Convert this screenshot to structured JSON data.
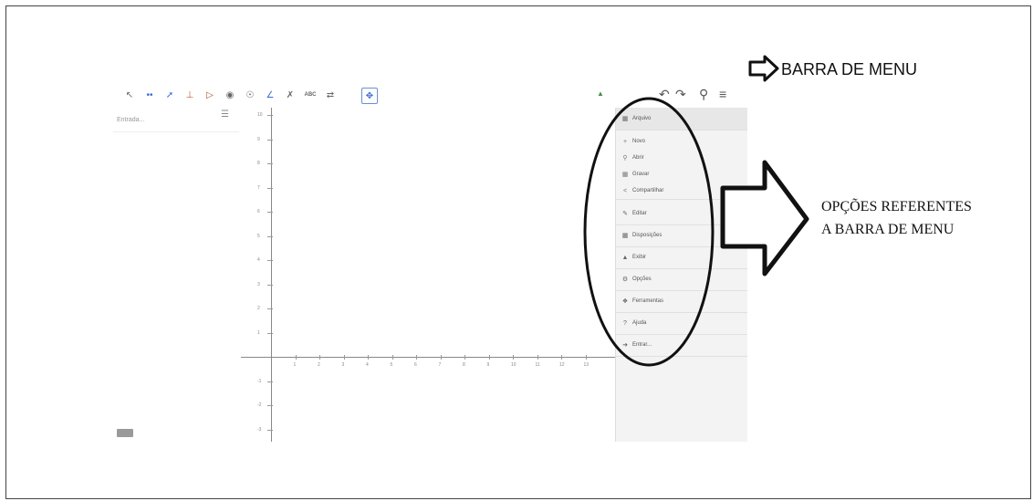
{
  "toolbar": {
    "tools": [
      "move-tool",
      "point-tool",
      "line-tool",
      "perpendicular-tool",
      "polygon-tool",
      "circle-tool",
      "circle-three-points-tool",
      "angle-tool",
      "reflect-tool",
      "text-tool",
      "slider-tool",
      "move-graphics-tool"
    ],
    "text_tool_label": "ABC",
    "right_icons": [
      "undo-icon",
      "redo-icon",
      "search-icon",
      "hamburger-menu-icon"
    ]
  },
  "algebra": {
    "input_placeholder": "Entrada..."
  },
  "graphics": {
    "y_ticks": [
      "10",
      "9",
      "8",
      "7",
      "6",
      "5",
      "4",
      "3",
      "2",
      "1",
      "-1",
      "-2",
      "-3"
    ],
    "x_ticks": [
      "1",
      "2",
      "3",
      "4",
      "5",
      "6",
      "7",
      "8",
      "9",
      "10",
      "11",
      "12",
      "13"
    ]
  },
  "menu": {
    "header": "Arquivo",
    "file_items": [
      {
        "label": "Novo",
        "icon": "plus-icon"
      },
      {
        "label": "Abrir",
        "icon": "search-icon"
      },
      {
        "label": "Gravar",
        "icon": "save-icon"
      },
      {
        "label": "Compartilhar",
        "icon": "share-icon"
      }
    ],
    "sections": [
      {
        "label": "Editar",
        "icon": "pencil-icon"
      },
      {
        "label": "Disposições",
        "icon": "layout-icon"
      },
      {
        "label": "Exibir",
        "icon": "view-icon"
      },
      {
        "label": "Opções",
        "icon": "gear-icon"
      },
      {
        "label": "Ferramentas",
        "icon": "tools-icon"
      },
      {
        "label": "Ajuda",
        "icon": "help-icon"
      },
      {
        "label": "Entrar...",
        "icon": "sign-in-icon"
      }
    ]
  },
  "annotations": {
    "menu_bar": "BARRA DE MENU",
    "options_line1": "OPÇÕES REFERENTES",
    "options_line2": "A BARRA DE MENU"
  }
}
